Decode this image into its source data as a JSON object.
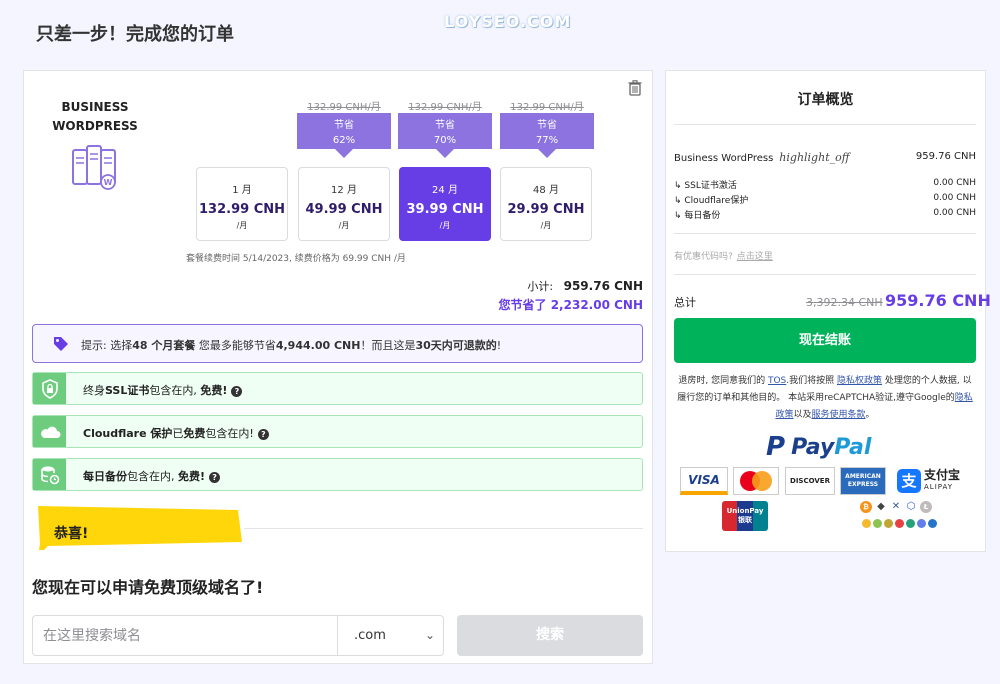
{
  "page": {
    "title": "只差一步！完成您的订单",
    "watermark": "LOYSEO.COM"
  },
  "product": {
    "name_line1": "BUSINESS",
    "name_line2": "WORDPRESS"
  },
  "plans": [
    {
      "months": "1 月",
      "price": "132.99 CNH",
      "unit": "/月",
      "original": "",
      "save_label": "",
      "save_pct": "",
      "selected": false
    },
    {
      "months": "12 月",
      "price": "49.99 CNH",
      "unit": "/月",
      "original": "132.99 CNH/月",
      "save_label": "节省",
      "save_pct": "62%",
      "selected": false
    },
    {
      "months": "24 月",
      "price": "39.99 CNH",
      "unit": "/月",
      "original": "132.99 CNH/月",
      "save_label": "节省",
      "save_pct": "70%",
      "selected": true
    },
    {
      "months": "48 月",
      "price": "29.99 CNH",
      "unit": "/月",
      "original": "132.99 CNH/月",
      "save_label": "节省",
      "save_pct": "77%",
      "selected": false
    }
  ],
  "renew_note": "套餐续费时间 5/14/2023, 续费价格为 69.99 CNH /月",
  "subtotal": {
    "label": "小计:",
    "value": "959.76 CNH"
  },
  "saved": "您节省了 2,232.00 CNH",
  "tip": {
    "prefix": "提示: 选择",
    "b1": "48 个月套餐",
    "mid": " 您最多能够节省",
    "b2": "4,944.00 CNH",
    "mid2": "！而且这是",
    "b3": "30天内可退款的",
    "end": "!"
  },
  "features": [
    {
      "a": "终身",
      "b": "SSL证书",
      "c": "包含在内, ",
      "d": "免费!"
    },
    {
      "a": "",
      "b": "Cloudflare 保护",
      "c": "已",
      "d": "免费",
      "e": "包含在内!"
    },
    {
      "a": "",
      "b": "每日备份",
      "c": "包含在内, ",
      "d": "免费!"
    }
  ],
  "congrats": "恭喜!",
  "domain": {
    "headline": "您现在可以申请免费顶级域名了!",
    "placeholder": "在这里搜索域名",
    "tld": ".com",
    "search_label": "搜索"
  },
  "summary": {
    "title": "订单概览",
    "product": "Business WordPress",
    "highlight": "highlight_off",
    "product_price": "959.76 CNH",
    "items": [
      {
        "label": "↳ SSL证书激活",
        "value": "0.00 CNH"
      },
      {
        "label": "↳ Cloudflare保护",
        "value": "0.00 CNH"
      },
      {
        "label": "↳ 每日备份",
        "value": "0.00 CNH"
      }
    ],
    "coupon_q": "有优惠代码吗?",
    "coupon_link": "点击这里",
    "total_label": "总计",
    "total_old": "3,392.34 CNH",
    "total_new": "959.76 CNH",
    "checkout_label": "现在结账",
    "legal": {
      "t1": "退房时, 您同意我们的 ",
      "l1": "TOS",
      "t2": ".我们将按照 ",
      "l2": "隐私权政策",
      "t3": " 处理您的个人数据, 以履行您的订单和其他目的。 本站采用reCAPTCHA验证,遵守Google的",
      "l3": "隐私政策",
      "t4": "以及",
      "l4": "服务使用条款",
      "t5": "。"
    },
    "paypal": {
      "pay": "Pay",
      "pal": "Pal"
    },
    "cards": {
      "visa": "VISA",
      "discover": "DISCOVER",
      "amex": "AMERICAN EXPRESS",
      "alipay": "支付宝",
      "alipay_en": "ALIPAY",
      "unionpay": "UnionPay",
      "unionpay_cn": "银联"
    }
  },
  "colors": {
    "accent": "#673de6",
    "accent_light": "#8c73e0",
    "checkout": "#00b35a",
    "feature_green": "#6dcc7e",
    "congrats_yellow": "#ffd60a"
  }
}
